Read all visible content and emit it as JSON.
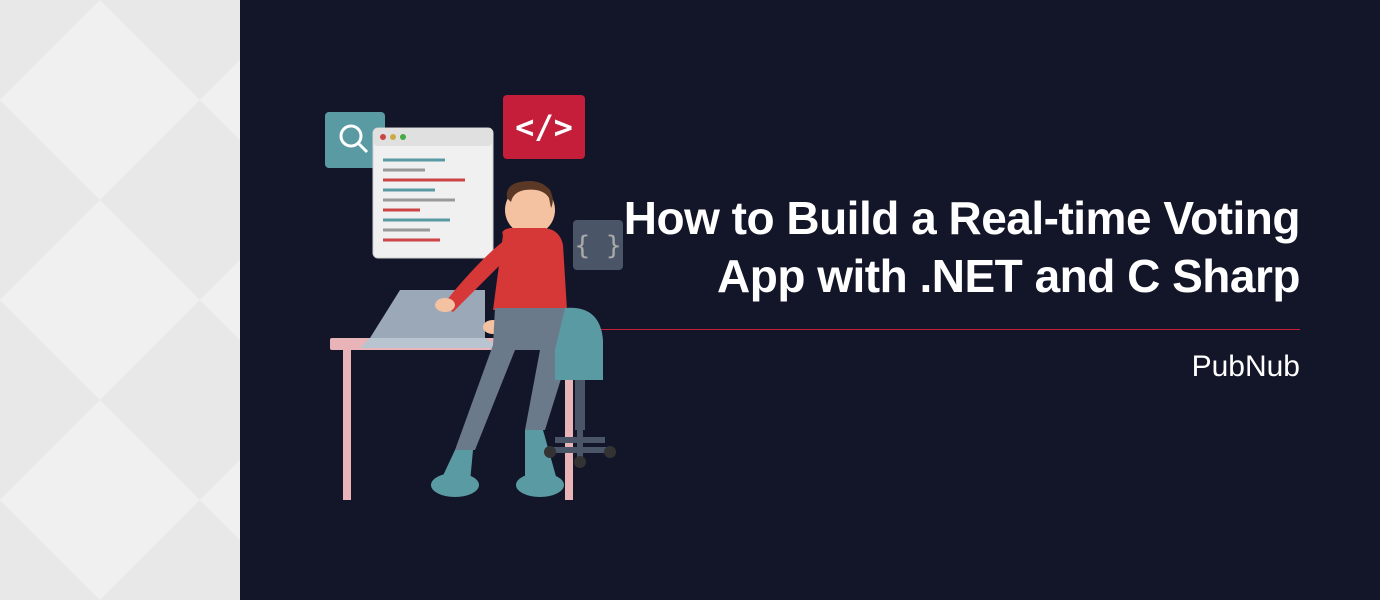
{
  "hero": {
    "title_line1": "How to Build a Real-time Voting",
    "title_line2": "App with .NET and C Sharp",
    "brand": "PubNub"
  },
  "illustration": {
    "icons": {
      "search": "search-icon",
      "code": "code-icon",
      "braces": "braces-icon"
    }
  },
  "colors": {
    "background_dark": "#131628",
    "background_light": "#f0f0f0",
    "accent_red": "#c41e3a",
    "teal": "#5a9aa3",
    "illustration_red": "#d63838"
  }
}
